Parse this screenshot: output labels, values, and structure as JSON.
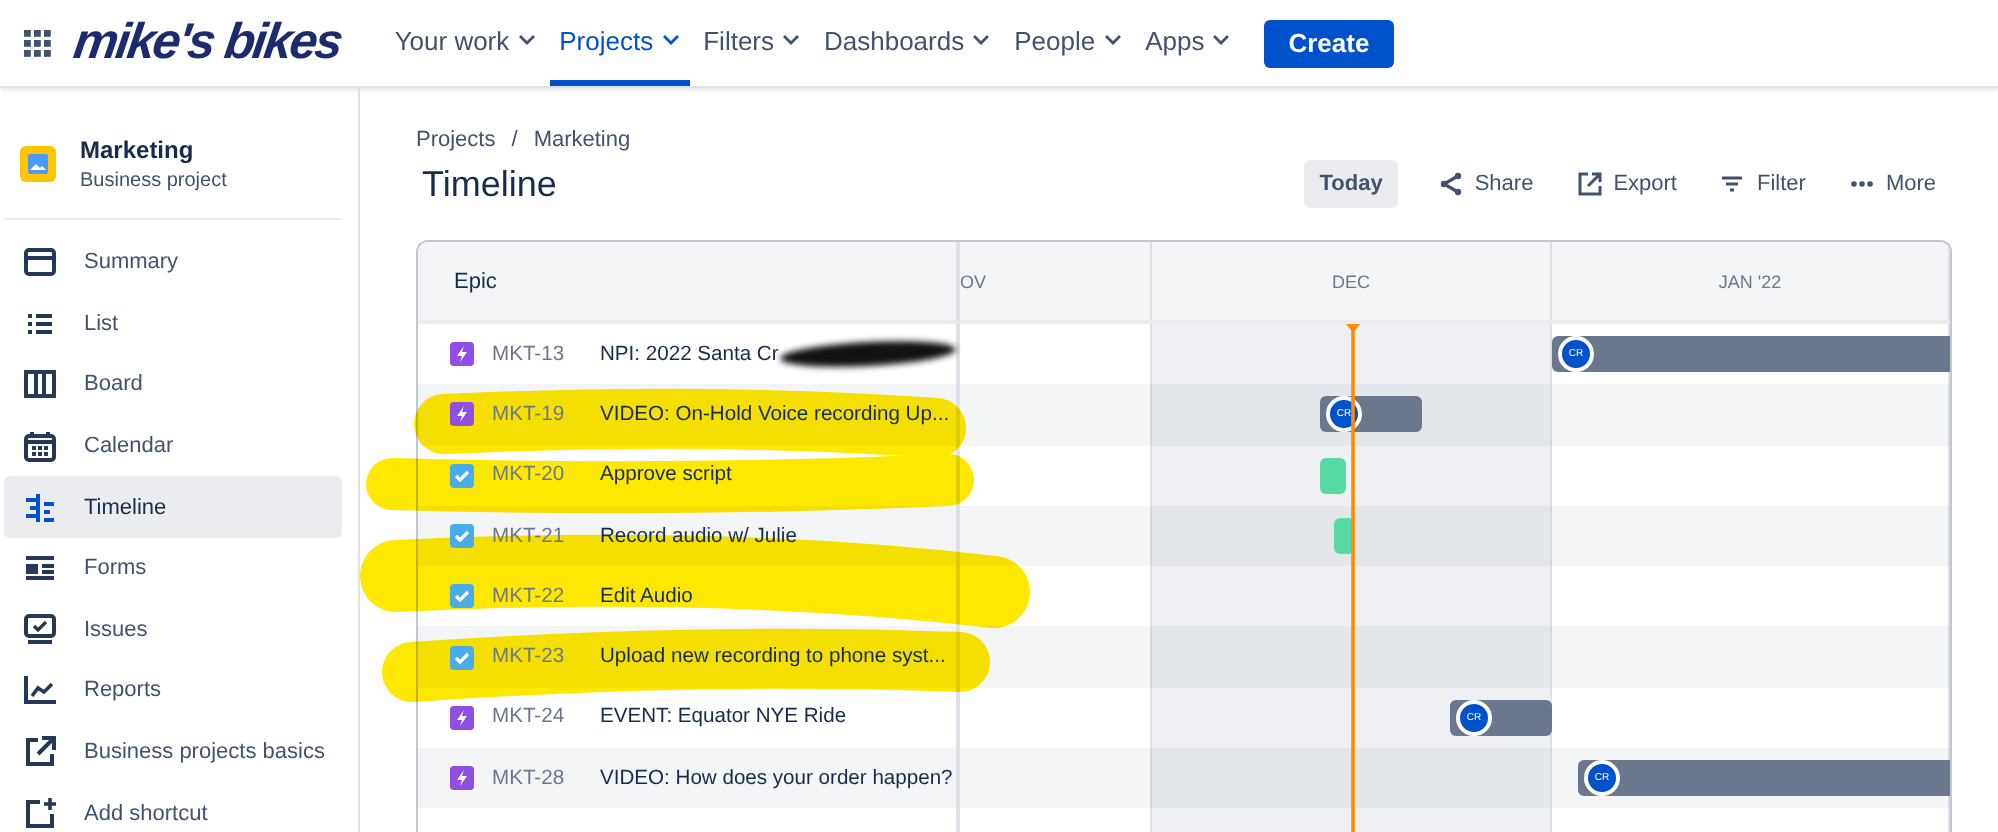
{
  "topbar": {
    "logo": "mike's bikes",
    "nav": [
      {
        "label": "Your work",
        "selected": false
      },
      {
        "label": "Projects",
        "selected": true
      },
      {
        "label": "Filters",
        "selected": false
      },
      {
        "label": "Dashboards",
        "selected": false
      },
      {
        "label": "People",
        "selected": false
      },
      {
        "label": "Apps",
        "selected": false
      }
    ],
    "create_button": "Create"
  },
  "sidebar": {
    "project": {
      "name": "Marketing",
      "type": "Business project"
    },
    "items": [
      {
        "label": "Summary",
        "selected": false
      },
      {
        "label": "List",
        "selected": false
      },
      {
        "label": "Board",
        "selected": false
      },
      {
        "label": "Calendar",
        "selected": false
      },
      {
        "label": "Timeline",
        "selected": true
      },
      {
        "label": "Forms",
        "selected": false
      },
      {
        "label": "Issues",
        "selected": false
      },
      {
        "label": "Reports",
        "selected": false
      },
      {
        "label": "Business projects basics",
        "selected": false
      },
      {
        "label": "Add shortcut",
        "selected": false
      }
    ]
  },
  "breadcrumbs": {
    "items": [
      "Projects",
      "Marketing"
    ],
    "separator": "/"
  },
  "page_title": "Timeline",
  "toolbar": [
    "Today",
    "Share",
    "Export",
    "Filter",
    "More"
  ],
  "timeline": {
    "column_header": "Epic",
    "months": [
      {
        "label": "OV",
        "current": false
      },
      {
        "label": "DEC",
        "current": true
      },
      {
        "label": "JAN '22",
        "current": false
      }
    ],
    "rows": [
      {
        "kind": "epic",
        "key": "MKT-13",
        "summary": "NPI: 2022 Santa Cr",
        "bar": {
          "kind": "epic",
          "assignee": "CR"
        }
      },
      {
        "kind": "epic",
        "key": "MKT-19",
        "summary": "VIDEO: On-Hold Voice recording Up...",
        "bar": {
          "kind": "epic",
          "assignee": "CR"
        }
      },
      {
        "kind": "task",
        "key": "MKT-20",
        "summary": "Approve script",
        "bar": {
          "kind": "task"
        }
      },
      {
        "kind": "task",
        "key": "MKT-21",
        "summary": "Record audio w/ Julie",
        "bar": {
          "kind": "task"
        }
      },
      {
        "kind": "task",
        "key": "MKT-22",
        "summary": "Edit Audio"
      },
      {
        "kind": "task",
        "key": "MKT-23",
        "summary": "Upload new recording to phone syst..."
      },
      {
        "kind": "epic",
        "key": "MKT-24",
        "summary": "EVENT: Equator NYE Ride",
        "bar": {
          "kind": "epic",
          "assignee": "CR"
        }
      },
      {
        "kind": "epic",
        "key": "MKT-28",
        "summary": "VIDEO: How does your order happen?",
        "bar": {
          "kind": "epic",
          "assignee": "CR"
        }
      }
    ]
  },
  "markup": {
    "highlight": true,
    "scribble": true
  }
}
